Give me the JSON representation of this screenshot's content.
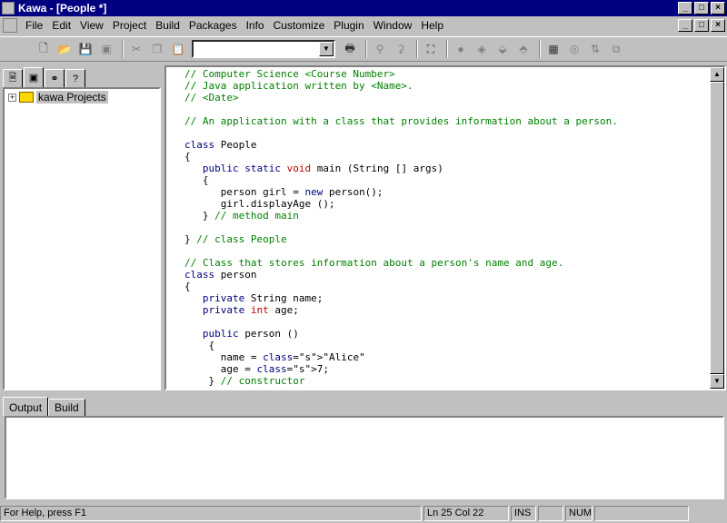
{
  "window": {
    "title": "Kawa - [People *]",
    "btn_min": "_",
    "btn_max": "□",
    "btn_close": "×"
  },
  "menubar": {
    "items": [
      "File",
      "Edit",
      "View",
      "Project",
      "Build",
      "Packages",
      "Info",
      "Customize",
      "Plugin",
      "Window",
      "Help"
    ]
  },
  "toolbar": {
    "combo_value": ""
  },
  "project_panel": {
    "root_label": "kawa Projects"
  },
  "code": [
    "// Computer Science <Course Number>",
    "// Java application written by <Name>.",
    "// <Date>",
    "",
    "// An application with a class that provides information about a person.",
    "",
    "class People",
    "{",
    "   public static void main (String [] args)",
    "   {",
    "      person girl = new person();",
    "      girl.displayAge ();",
    "   } // method main",
    "",
    "} // class People",
    "",
    "// Class that stores information about a person's name and age.",
    "class person",
    "{",
    "   private String name;",
    "   private int age;",
    "",
    "   public person ()",
    "    {",
    "      name = \"Alice\"",
    "      age = 7;",
    "    } // constructor"
  ],
  "output_tabs": [
    "Output",
    "Build"
  ],
  "statusbar": {
    "help": "For Help, press F1",
    "position": "Ln 25 Col 22",
    "ins": "INS",
    "num": "NUM"
  }
}
